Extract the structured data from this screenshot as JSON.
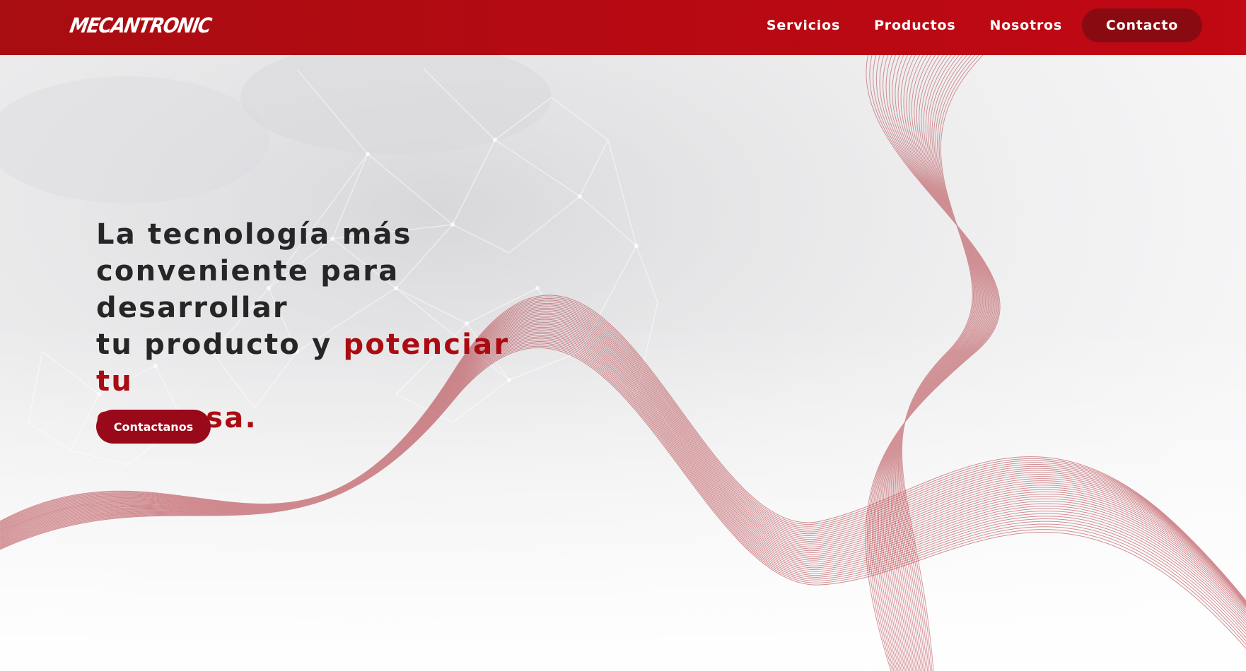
{
  "brand": {
    "logo_text": "MECANTRONIC",
    "primary_color": "#b00c12",
    "dark_button_color": "#8a0a12",
    "accent_text_color": "#ab0b12"
  },
  "nav": {
    "items": [
      {
        "label": "Servicios"
      },
      {
        "label": "Productos"
      },
      {
        "label": "Nosotros"
      }
    ],
    "cta_label": "Contacto"
  },
  "hero": {
    "title_line1": "La tecnología más",
    "title_line2": "conveniente para desarrollar",
    "title_line3_plain": "tu producto y ",
    "title_line3_accent": "potenciar tu",
    "title_line4_accent": "empresa.",
    "button_label": "Contactanos"
  }
}
